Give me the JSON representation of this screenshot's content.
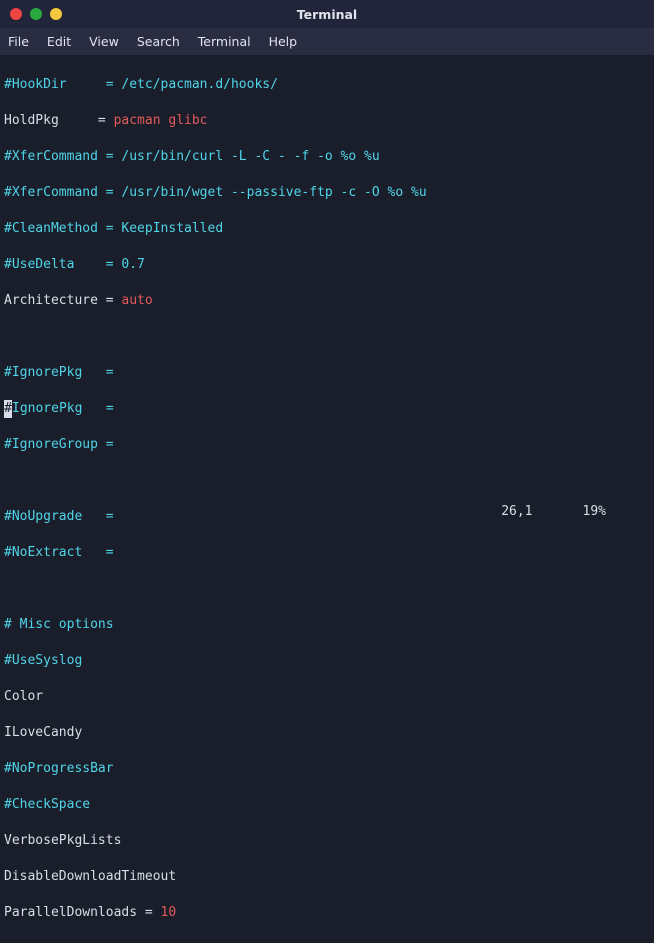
{
  "window": {
    "title": "Terminal"
  },
  "menubar": {
    "file": "File",
    "edit": "Edit",
    "view": "View",
    "search": "Search",
    "terminal": "Terminal",
    "help": "Help"
  },
  "lines": {
    "l1a": "#HookDir     = ",
    "l1b": "/etc/pacman.d/hooks/",
    "l2a": "HoldPkg     = ",
    "l2b": "pacman glibc",
    "l3a": "#XferCommand = ",
    "l3b": "/usr/bin/curl -L -C - -f -o %o %u",
    "l4a": "#XferCommand = ",
    "l4b": "/usr/bin/wget --passive-ftp -c -O %o %u",
    "l5a": "#CleanMethod = ",
    "l5b": "KeepInstalled",
    "l6a": "#UseDelta    = ",
    "l6b": "0.7",
    "l7a": "Architecture = ",
    "l7b": "auto",
    "l8": "#IgnorePkg   =",
    "l9cursor": "#",
    "l9rest": "IgnorePkg   =",
    "l10": "#IgnoreGroup =",
    "l11": "#NoUpgrade   =",
    "l12": "#NoExtract   =",
    "l13": "# Misc options",
    "l14": "#UseSyslog",
    "l15": "Color",
    "l16": "ILoveCandy",
    "l17": "#NoProgressBar",
    "l18": "#CheckSpace",
    "l19": "VerbosePkgLists",
    "l20": "DisableDownloadTimeout",
    "l21a": "ParallelDownloads = ",
    "l21b": "10"
  },
  "status": {
    "pos": "26,1",
    "pct": "19%"
  }
}
